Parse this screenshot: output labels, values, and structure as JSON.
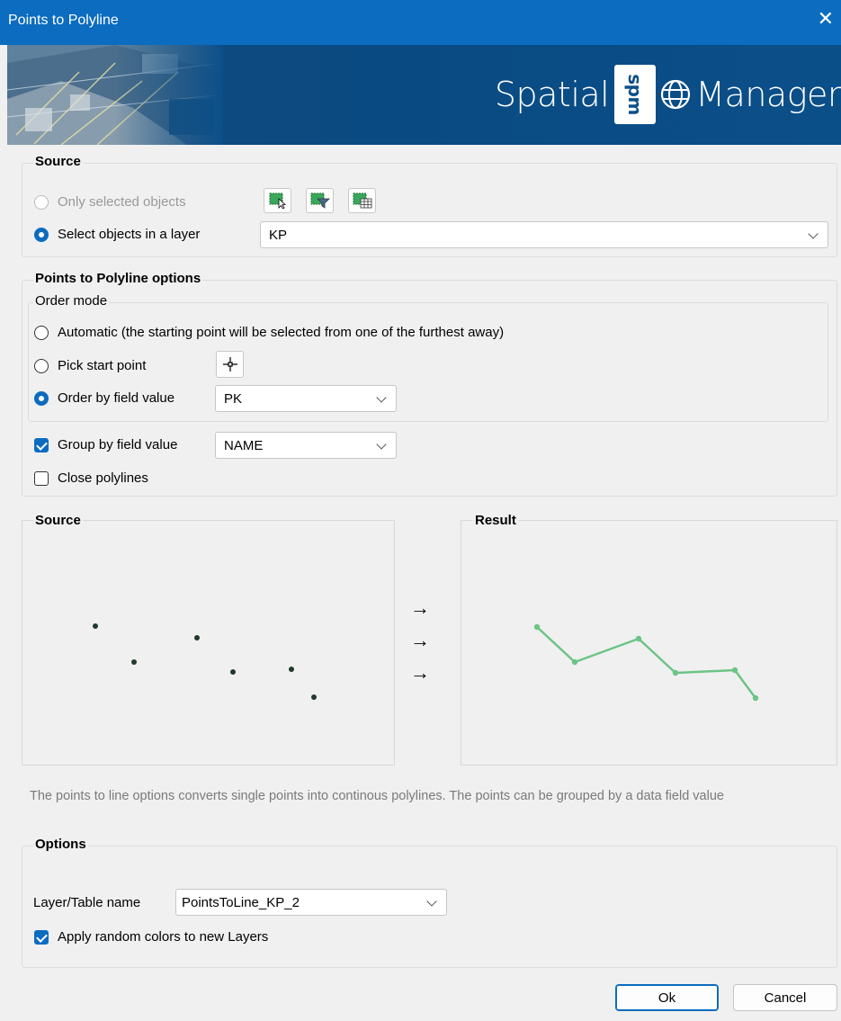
{
  "window": {
    "title": "Points to Polyline",
    "close_glyph": "✕"
  },
  "banner": {
    "brand_left": "Spatial",
    "brand_box": "spm",
    "brand_right": "Manager"
  },
  "source_group": {
    "legend": "Source",
    "only_selected_label": "Only selected objects",
    "only_selected_state": "disabled",
    "select_in_layer_label": "Select objects in a layer",
    "select_in_layer_checked": true,
    "layer_value": "KP",
    "tool_icons": [
      "select-objects-icon",
      "filter-icon",
      "select-table-icon"
    ]
  },
  "options_group": {
    "legend": "Points to Polyline options",
    "order_mode": {
      "legend": "Order mode",
      "automatic_label": "Automatic (the starting point will be selected from one of the furthest away)",
      "pick_start_label": "Pick start point",
      "order_by_field_label": "Order by field value",
      "order_by_field_checked": true,
      "order_field_value": "PK"
    },
    "group_by_label": "Group by field value",
    "group_by_checked": true,
    "group_field_value": "NAME",
    "close_polylines_label": "Close polylines",
    "close_polylines_checked": false
  },
  "preview": {
    "source_title": "Source",
    "result_title": "Result",
    "arrow": "→",
    "line_color": "#6cc486",
    "point_color": "#1f3a2a"
  },
  "description": "The points to line options converts single points into continous polylines. The points can be grouped by a data field value",
  "output_group": {
    "legend": "Options",
    "layer_table_label": "Layer/Table name",
    "layer_table_value": "PointsToLine_KP_2",
    "random_colors_label": "Apply random colors to new Layers",
    "random_colors_checked": true
  },
  "buttons": {
    "ok": "Ok",
    "cancel": "Cancel"
  }
}
